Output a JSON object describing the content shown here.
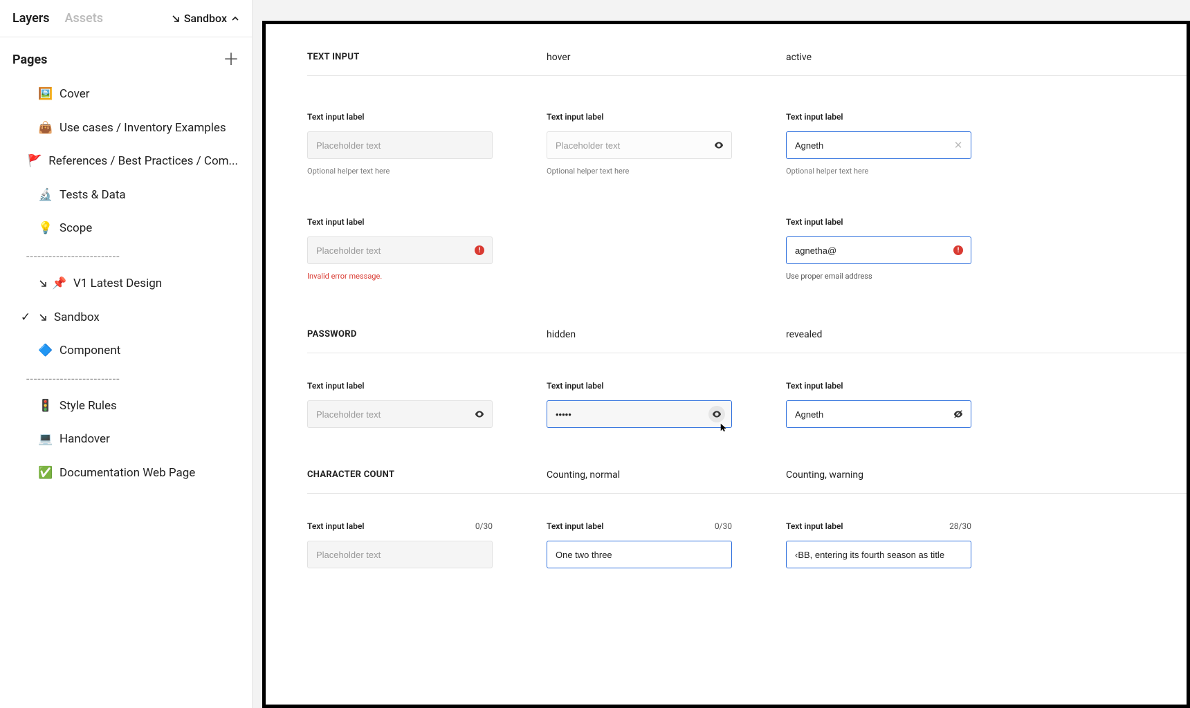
{
  "sidebar": {
    "tabs": {
      "layers": "Layers",
      "assets": "Assets"
    },
    "project": "Sandbox",
    "pages_label": "Pages",
    "divider": "-------------------------",
    "pages": [
      {
        "icon": "🖼️",
        "label": "Cover"
      },
      {
        "icon": "👜",
        "label": "Use cases / Inventory Examples"
      },
      {
        "icon": "🚩",
        "label": "References  / Best Practices / Com..."
      },
      {
        "icon": "🔬",
        "label": "Tests & Data"
      },
      {
        "icon": "💡",
        "label": "Scope"
      },
      {
        "icon": "📌",
        "label": "V1  Latest Design",
        "arrow": true
      },
      {
        "icon": "",
        "label": "Sandbox",
        "checked": true,
        "arrow": true
      },
      {
        "icon": "🔷",
        "label": "Component"
      },
      {
        "icon": "🚦",
        "label": "Style Rules"
      },
      {
        "icon": "💻",
        "label": "Handover"
      },
      {
        "icon": "✅",
        "label": "Documentation Web Page"
      }
    ]
  },
  "canvas": {
    "sections": {
      "text_input": {
        "title": "TEXT INPUT",
        "cols": {
          "hover": "hover",
          "active": "active"
        },
        "row1": {
          "label": "Text input label",
          "placeholder": "Placeholder text",
          "helper": "Optional helper text here",
          "active_value": "Agneth"
        },
        "row2": {
          "label": "Text input label",
          "placeholder": "Placeholder text",
          "err_msg": "Invalid error message.",
          "active_value": "agnetha@",
          "active_helper": "Use proper email address"
        }
      },
      "password": {
        "title": "PASSWORD",
        "cols": {
          "hidden": "hidden",
          "revealed": "revealed"
        },
        "label": "Text input label",
        "placeholder": "Placeholder text",
        "hidden_value": "•••••",
        "revealed_value": "Agneth"
      },
      "char_count": {
        "title": "CHARACTER COUNT",
        "cols": {
          "normal": "Counting, normal",
          "warning": "Counting, warning"
        },
        "label": "Text input label",
        "placeholder": "Placeholder text",
        "count_default": "0/30",
        "count_normal": "0/30",
        "count_warning": "28/30",
        "normal_value": "One two three",
        "warning_value": "‹BB, entering its fourth season as title partner, is conti"
      }
    }
  }
}
